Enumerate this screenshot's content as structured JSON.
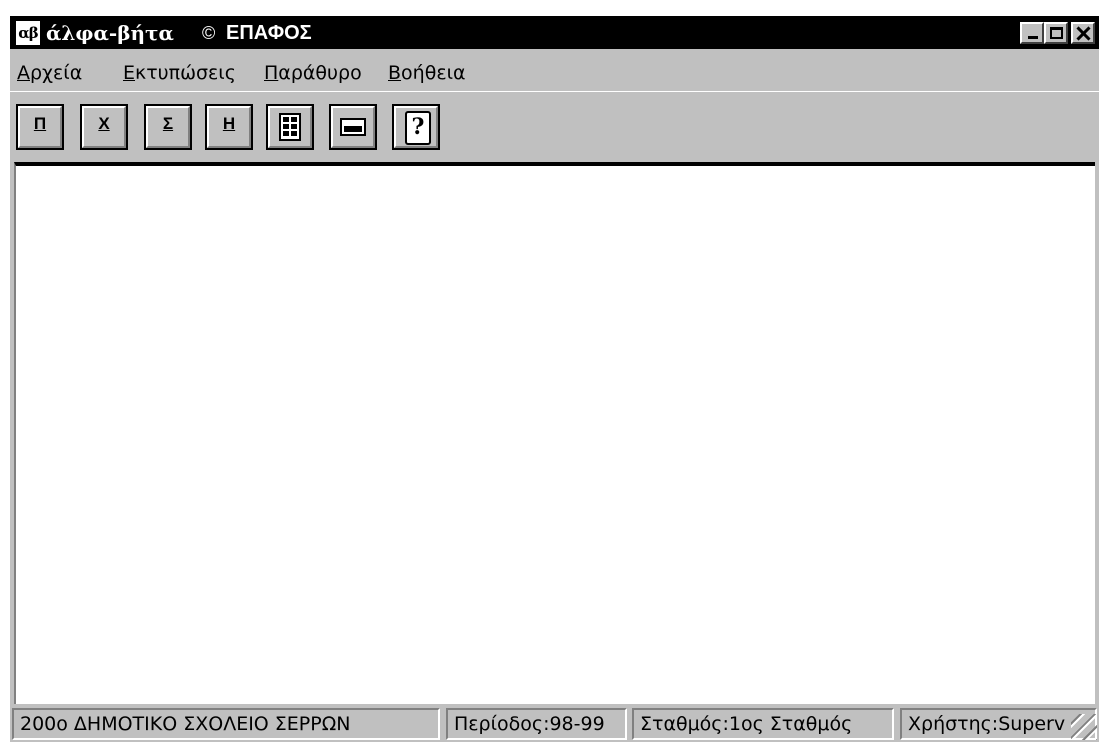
{
  "titlebar": {
    "app_name": "άλφα-βήτα",
    "product": "ΕΠΑΦΟΣ",
    "logo_icon": "alpha-beta-logo-icon",
    "logo_text": "αβ"
  },
  "menu": {
    "items": [
      "Αρχεία",
      "Εκτυπώσεις",
      "Παράθυρο",
      "Βοήθεια"
    ]
  },
  "toolbar": {
    "buttons": [
      "Π",
      "Χ",
      "Σ",
      "Η"
    ],
    "icons": [
      "calculator-icon",
      "keyboard-icon",
      "help-icon"
    ]
  },
  "status": {
    "school": "200ο ΔΗΜΟΤΙΚΟ ΣΧΟΛΕΙΟ ΣΕΡΡΩΝ",
    "period": "Περίοδος:98-99",
    "station": "Σταθμός:1ος Σταθμός",
    "user": "Χρήστης:Superv"
  },
  "colors": {
    "titlebar": "#000000",
    "face": "#c0c0c0",
    "workspace": "#ffffff"
  }
}
